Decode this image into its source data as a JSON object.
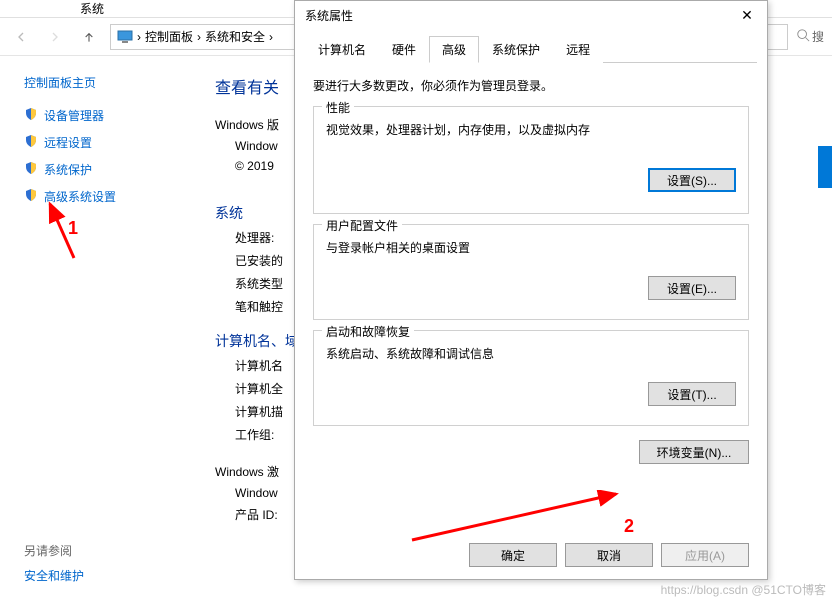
{
  "titlebar": {
    "title": "系统"
  },
  "breadcrumb": {
    "items": [
      "控制面板",
      "系统和安全"
    ]
  },
  "search": {
    "placeholder": "搜"
  },
  "sidebar": {
    "home": "控制面板主页",
    "items": [
      {
        "label": "设备管理器"
      },
      {
        "label": "远程设置"
      },
      {
        "label": "系统保护"
      },
      {
        "label": "高级系统设置"
      }
    ]
  },
  "content": {
    "heading": "查看有关",
    "winver_label": "Windows 版",
    "win_indent": "Window",
    "copyright": "© 2019",
    "system_heading": "系统",
    "rows": [
      "处理器:",
      "已安装的",
      "系统类型",
      "笔和触控"
    ],
    "computer_heading": "计算机名、域",
    "comp_rows": [
      "计算机名",
      "计算机全",
      "计算机描",
      "工作组:"
    ],
    "activation_heading": "Windows 激",
    "act_rows": [
      "Window",
      "产品 ID:"
    ]
  },
  "see_also": {
    "header": "另请参阅",
    "link": "安全和维护"
  },
  "dialog": {
    "title": "系统属性",
    "tabs": [
      "计算机名",
      "硬件",
      "高级",
      "系统保护",
      "远程"
    ],
    "active_tab": 2,
    "admin_note": "要进行大多数更改，你必须作为管理员登录。",
    "perf": {
      "title": "性能",
      "desc": "视觉效果，处理器计划，内存使用，以及虚拟内存",
      "btn": "设置(S)..."
    },
    "profile": {
      "title": "用户配置文件",
      "desc": "与登录帐户相关的桌面设置",
      "btn": "设置(E)..."
    },
    "startup": {
      "title": "启动和故障恢复",
      "desc": "系统启动、系统故障和调试信息",
      "btn": "设置(T)..."
    },
    "env_btn": "环境变量(N)...",
    "ok": "确定",
    "cancel": "取消",
    "apply": "应用(A)"
  },
  "annotations": {
    "one": "1",
    "two": "2"
  },
  "watermark": "https://blog.csdn @51CTO博客"
}
